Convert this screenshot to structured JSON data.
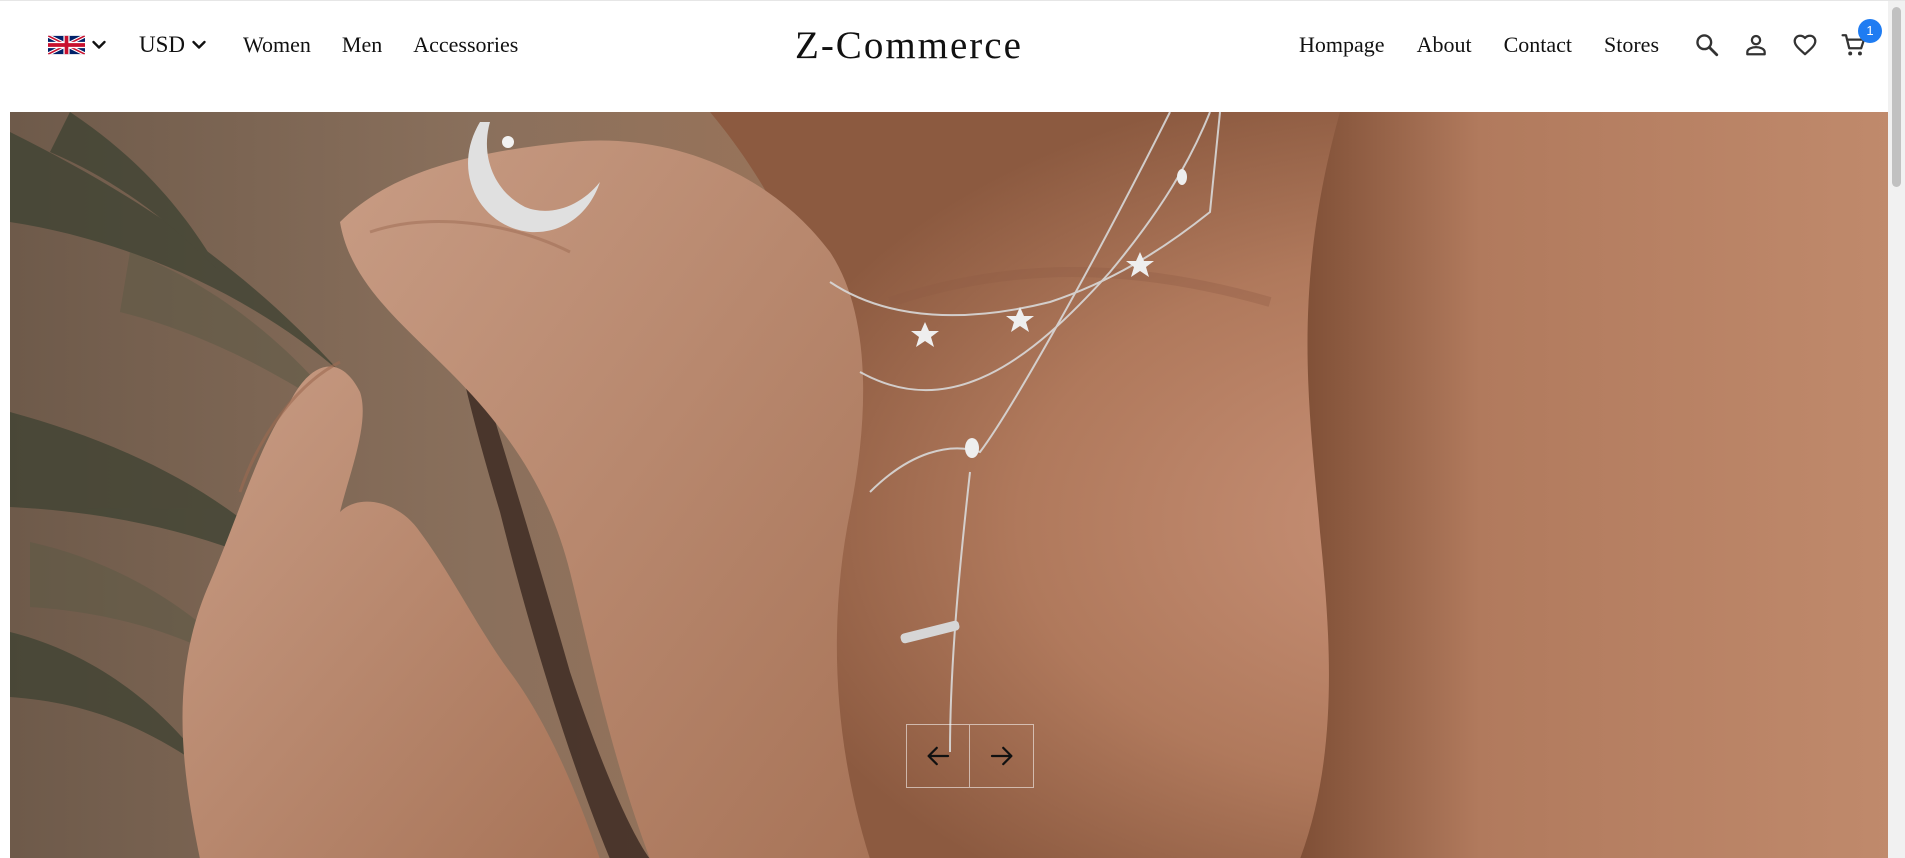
{
  "header": {
    "language": {
      "icon": "uk-flag-icon",
      "chevron": "chevron-down-icon"
    },
    "currency": {
      "label": "USD",
      "chevron": "chevron-down-icon"
    },
    "nav_left": [
      {
        "label": "Women"
      },
      {
        "label": "Men"
      },
      {
        "label": "Accessories"
      }
    ],
    "brand": "Z-Commerce",
    "nav_right": [
      {
        "label": "Hompage"
      },
      {
        "label": "About"
      },
      {
        "label": "Contact"
      },
      {
        "label": "Stores"
      }
    ],
    "icons": {
      "search": "search-icon",
      "account": "user-icon",
      "wishlist": "heart-icon",
      "cart": "cart-icon"
    },
    "cart_count": "1",
    "badge_color": "#1f7cf2"
  },
  "hero": {
    "image": "jewelry-model-photo",
    "controls": {
      "prev": "arrow-left-icon",
      "next": "arrow-right-icon"
    }
  }
}
